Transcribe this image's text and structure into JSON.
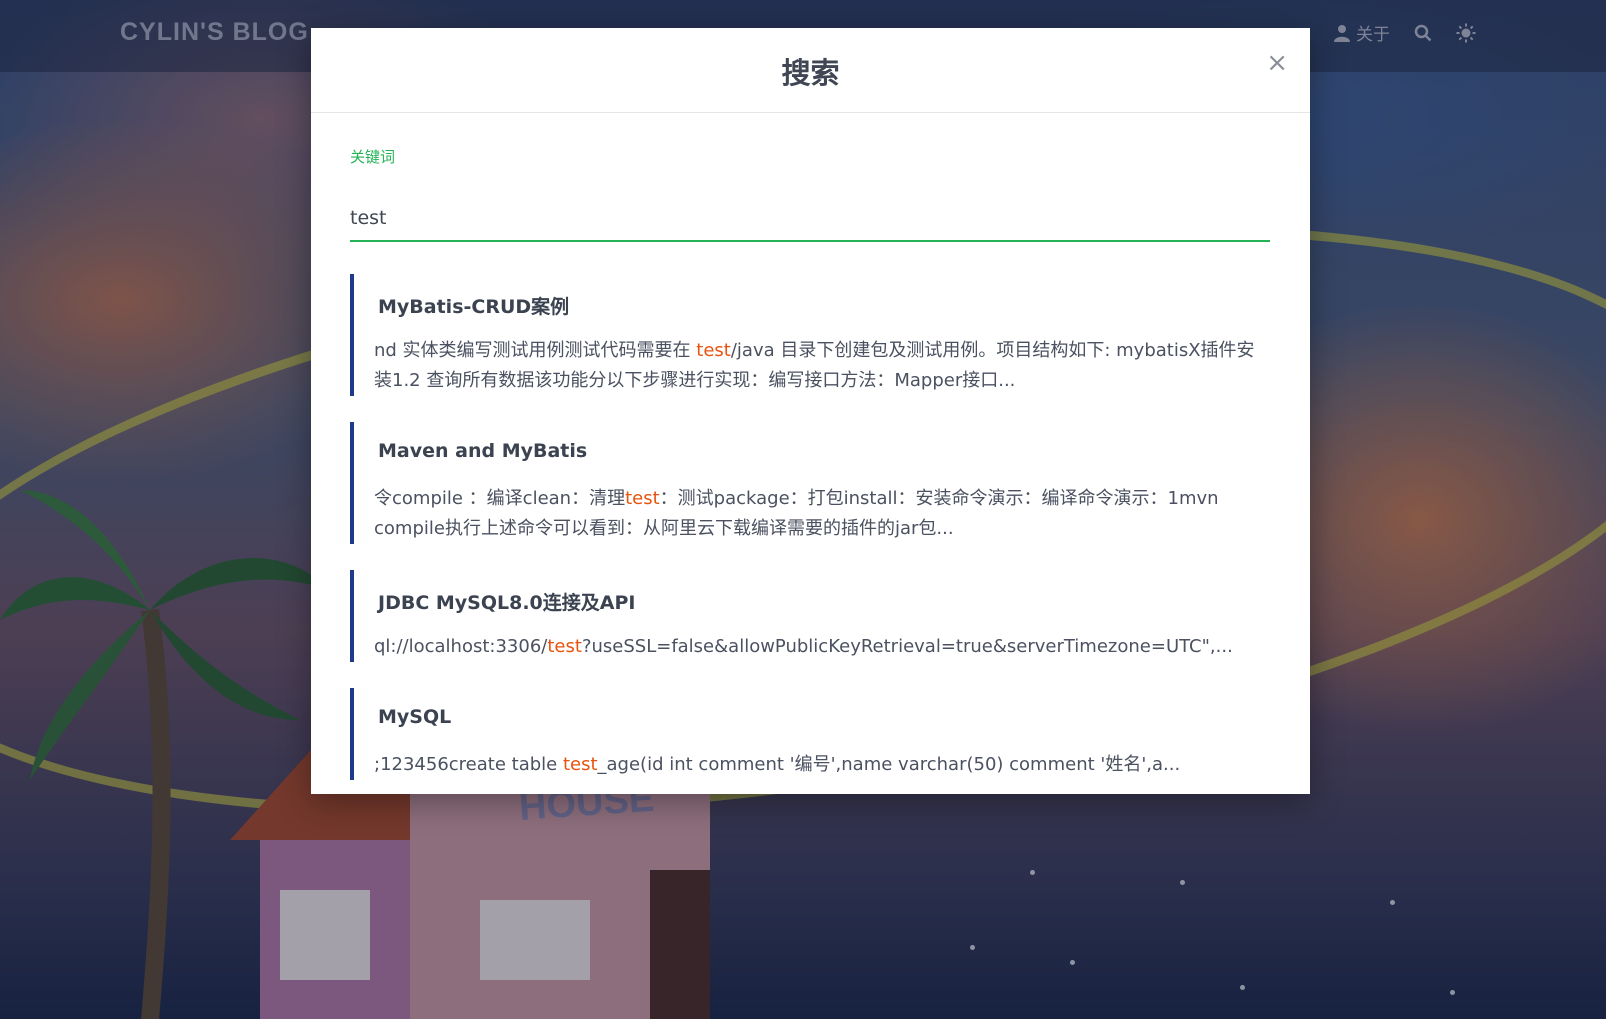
{
  "navbar": {
    "brand": "CYLIN'S BLOG",
    "items": [
      {
        "label": "关于",
        "icon": "user-icon"
      }
    ],
    "icons": [
      "search-icon",
      "theme-toggle-icon"
    ]
  },
  "modal": {
    "title": "搜索",
    "close_label": "×",
    "field_label": "关键词",
    "query": "test",
    "highlight_color": "#e8530e",
    "accent_color": "#26b356",
    "results": [
      {
        "title": "MyBatis-CRUD案例",
        "pre": "nd 实体类编写测试用例测试代码需要在 ",
        "match": "test",
        "post": "/java 目录下创建包及测试用例。项目结构如下: mybatisX插件安装1.2 查询所有数据该功能分以下步骤进行实现：编写接口方法：Mapper接口..."
      },
      {
        "title": "Maven and MyBatis",
        "pre": "令compile ：编译clean：清理",
        "match": "test",
        "post": "：测试package：打包install：安装命令演示：编译命令演示：1mvn compile执行上述命令可以看到：从阿里云下载编译需要的插件的jar包..."
      },
      {
        "title": "JDBC MySQL8.0连接及API",
        "pre": "ql://localhost:3306/",
        "match": "test",
        "post": "?useSSL=false&allowPublicKeyRetrieval=true&serverTimezone=UTC\",..."
      },
      {
        "title": "MySQL",
        "pre": ";123456create table ",
        "match": "test",
        "post": "_age(id int comment '编号',name varchar(50) comment '姓名',a..."
      }
    ]
  }
}
